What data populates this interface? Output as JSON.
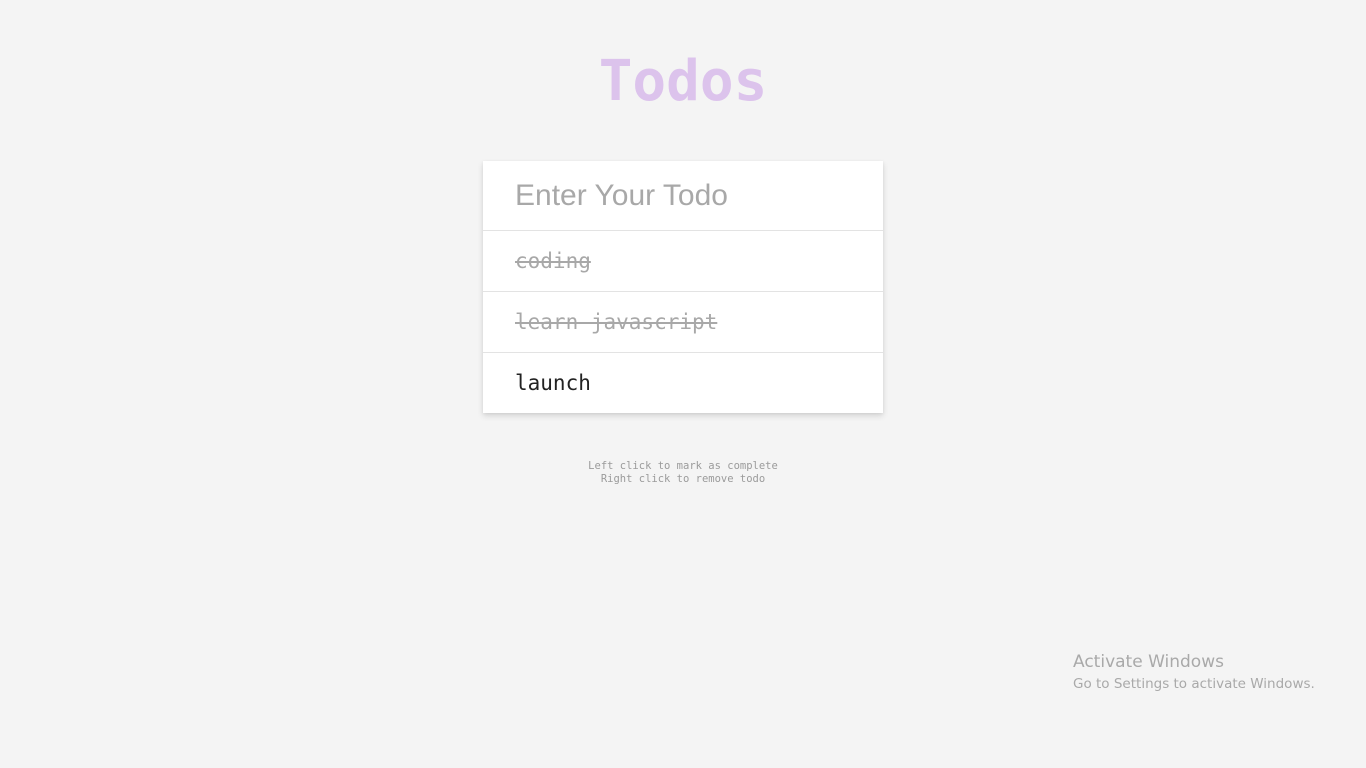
{
  "header": {
    "title": "Todos"
  },
  "input": {
    "placeholder": "Enter Your Todo",
    "value": ""
  },
  "todos": [
    {
      "text": "coding",
      "completed": true
    },
    {
      "text": "learn javascript",
      "completed": true
    },
    {
      "text": "launch",
      "completed": false
    }
  ],
  "hints": {
    "left_click": "Left click to mark as complete",
    "right_click": "Right click to remove todo"
  },
  "watermark": {
    "title": "Activate Windows",
    "subtitle": "Go to Settings to activate Windows."
  },
  "colors": {
    "background": "#f4f4f4",
    "title": "#dcc3ec",
    "completed_text": "#a8a8a8",
    "active_text": "#222222"
  }
}
